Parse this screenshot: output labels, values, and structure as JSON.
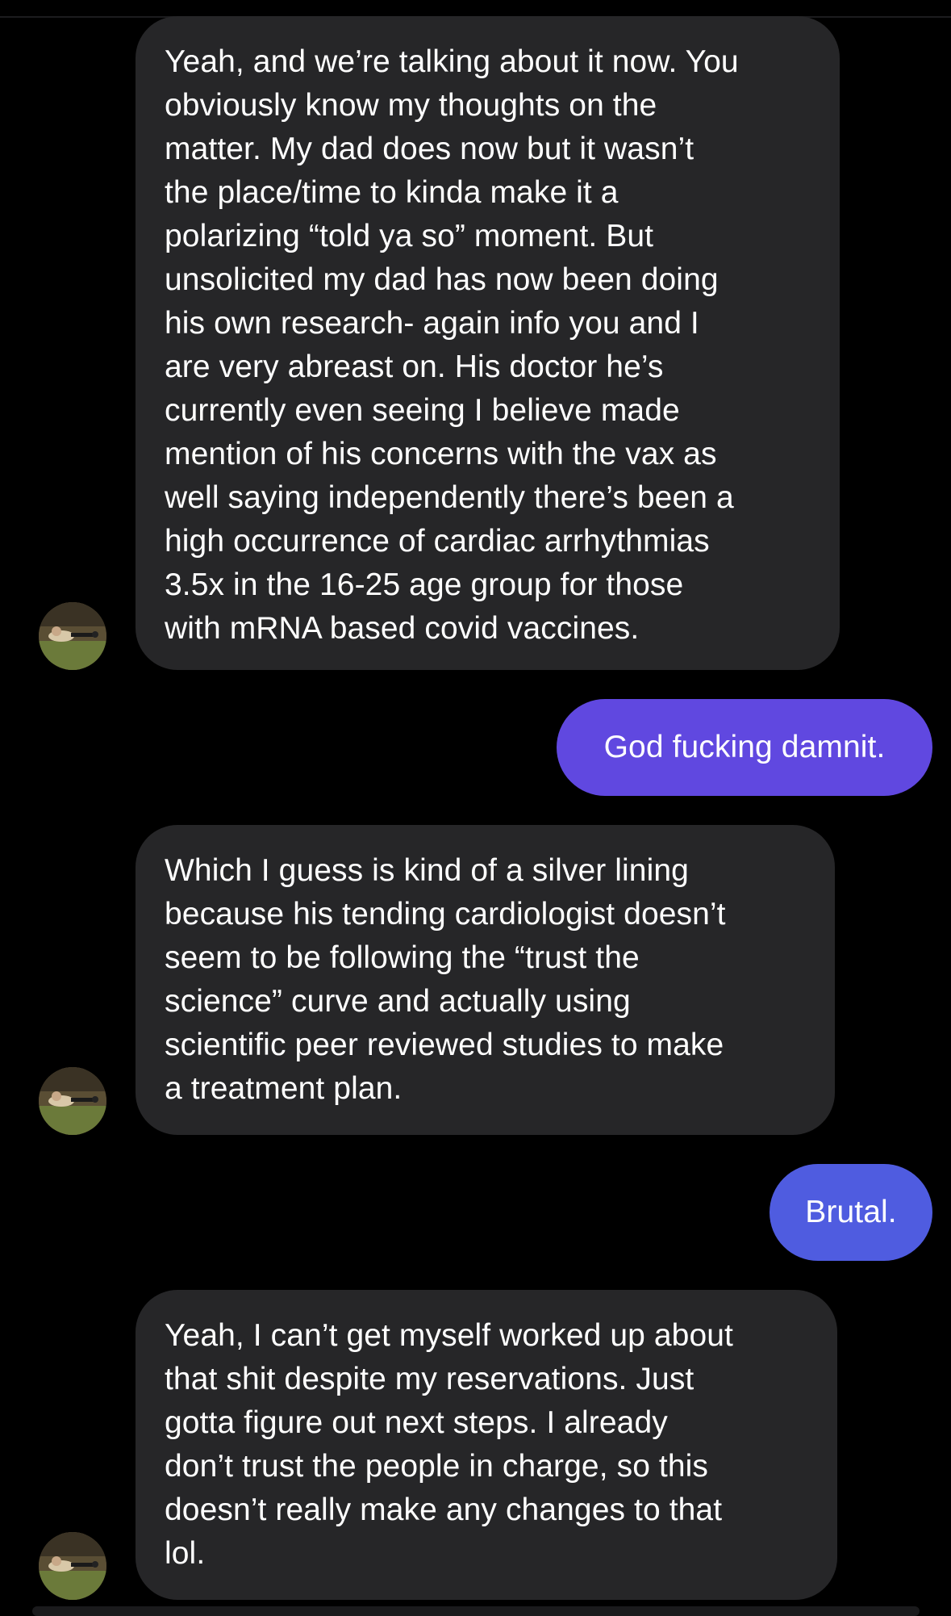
{
  "colors": {
    "background": "#000000",
    "incoming_bubble": "#262628",
    "outgoing_bubble_1": "#6048E0",
    "outgoing_bubble_2": "#4F5CE0"
  },
  "messages": [
    {
      "direction": "incoming",
      "text": "Yeah, and we’re talking about it now. You\nobviously know my thoughts on the\nmatter. My dad does now but it wasn’t\nthe place/time to kinda make it a\npolarizing “told ya so” moment. But\nunsolicited my dad has now been doing\nhis own research- again info you and I\nare very abreast on. His doctor he’s\ncurrently even seeing I believe made\nmention of his concerns with the vax as\nwell saying independently there’s been a\nhigh occurrence of cardiac arrhythmias\n3.5x in the 16-25 age group for those\nwith mRNA based covid vaccines.",
      "avatar": "sender-avatar-icon"
    },
    {
      "direction": "outgoing",
      "text": "God fucking damnit."
    },
    {
      "direction": "incoming",
      "text": "Which I guess is kind of a silver lining\nbecause his tending cardiologist doesn’t\nseem to be following the “trust the\nscience” curve and actually using\nscientific peer reviewed studies to make\na treatment plan.",
      "avatar": "sender-avatar-icon"
    },
    {
      "direction": "outgoing",
      "text": "Brutal."
    },
    {
      "direction": "incoming",
      "text": "Yeah, I can’t get myself worked up about\nthat shit despite my reservations. Just\ngotta figure out next steps. I already\ndon’t trust the people in charge, so this\ndoesn’t really make any changes to that\nlol.",
      "avatar": "sender-avatar-icon"
    }
  ]
}
